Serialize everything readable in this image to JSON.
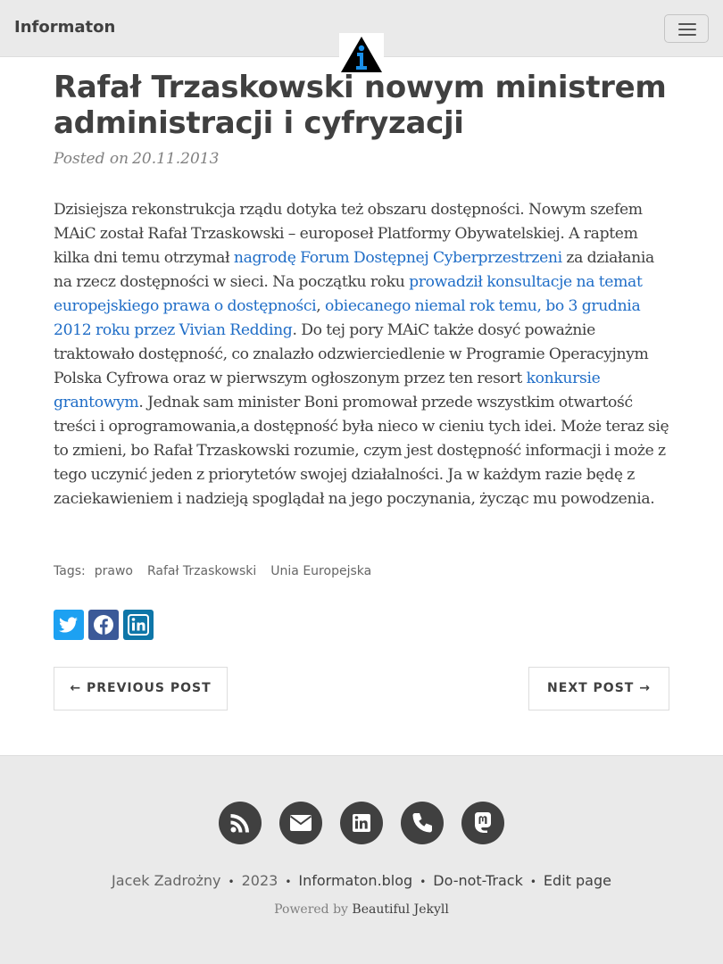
{
  "navbar": {
    "brand": "Informaton",
    "menu_icon": "hamburger-icon",
    "logo_icon": "info-logo-icon"
  },
  "post": {
    "title": "Rafał Trzaskowski nowym ministrem administracji i cyfryzacji",
    "posted_label": "Posted on",
    "date": "20.11.2013",
    "body": {
      "t1": "Dzisiejsza rekonstrukcja rządu dotyka też obszaru dostępności. Nowym szefem MAiC został Rafał Trzaskowski – europoseł Platformy Obywatelskiej. A raptem kilka dni temu otrzymał ",
      "link1": "nagrodę Forum Dostępnej Cyberprzestrzeni",
      "t2": " za działania na rzecz dostępności w sieci. Na początku roku ",
      "link2": "prowadził konsultacje na temat europejskiego prawa o dostępności",
      "t3": ", ",
      "link3": "obiecanego niemal rok temu, bo 3 grudnia 2012 roku przez Vivian Redding",
      "t4": ". Do tej pory MAiC także dosyć poważnie traktowało dostępność, co znalazło odzwierciedlenie w Programie Operacyjnym Polska Cyfrowa oraz w pierwszym ogłoszonym przez ten resort ",
      "link4": "konkursie grantowym",
      "t5": ". Jednak sam minister Boni promował przede wszystkim otwartość treści i oprogramowania,a dostępność była nieco w cieniu tych idei. Może teraz się to zmieni, bo Rafał Trzaskowski rozumie, czym jest dostępność informacji i może z tego uczynić jeden z priorytetów swojej działalności. Ja w każdym razie będę z zaciekawieniem i nadzieją spoglądał na jego poczynania, życząc mu powodzenia."
    }
  },
  "tags": {
    "label": "Tags:",
    "items": [
      "prawo",
      "Rafał Trzaskowski",
      "Unia Europejska"
    ]
  },
  "share": {
    "buttons": [
      {
        "icon": "twitter-icon",
        "color": "#1da1f2"
      },
      {
        "icon": "facebook-icon",
        "color": "#3b5998"
      },
      {
        "icon": "linkedin-icon",
        "color": "#0e76a8"
      }
    ]
  },
  "pager": {
    "prev": "← PREVIOUS POST",
    "next": "NEXT POST →"
  },
  "footer": {
    "icons": [
      "rss-icon",
      "envelope-icon",
      "linkedin-icon",
      "phone-icon",
      "mastodon-icon"
    ],
    "author": "Jacek Zadrożny",
    "year": "2023",
    "site": "Informaton.blog",
    "dnt": "Do-not-Track",
    "edit": "Edit page",
    "separator": "•",
    "powered_prefix": "Powered by",
    "powered_link": "Beautiful Jekyll"
  },
  "colors": {
    "link": "#1f6dc7",
    "text": "#404040",
    "navbar_bg": "#eaeaea",
    "footer_icon_bg": "#404040"
  }
}
